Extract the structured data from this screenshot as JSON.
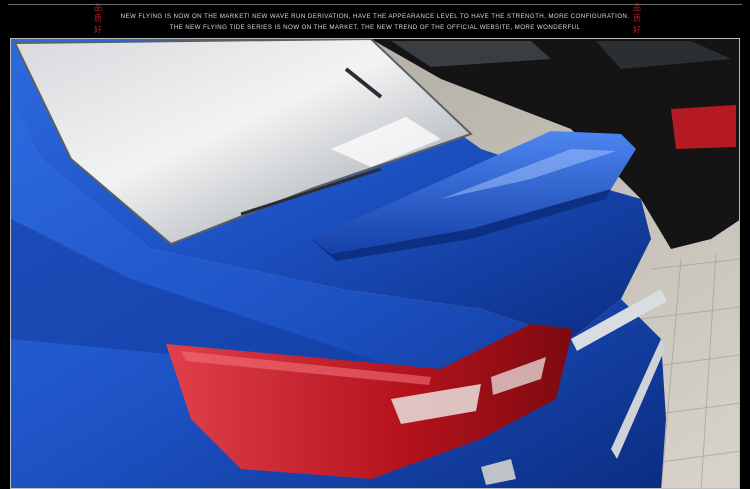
{
  "header": {
    "caption_line1": "NEW FLYING IS NOW ON THE MARKET! NEW WAVE RUN DERIVATION, HAVE THE APPEARANCE LEVEL TO HAVE THE STRENGTH, MORE CONFIGURATION.",
    "caption_line2": "THE NEW FLYING TIDE SERIES IS NOW ON THE MARKET, THE NEW TREND OF THE OFFICIAL WEBSITE, MORE WONDERFUL"
  },
  "photo": {
    "subject": "blue sedan rear with spoiler",
    "colors": {
      "car_blue": "#1f55c8",
      "car_blue_dark": "#0c2f86",
      "taillight_red": "#c8202a",
      "neighbor_car": "#151515",
      "pavement": "#c9c4bc"
    }
  }
}
